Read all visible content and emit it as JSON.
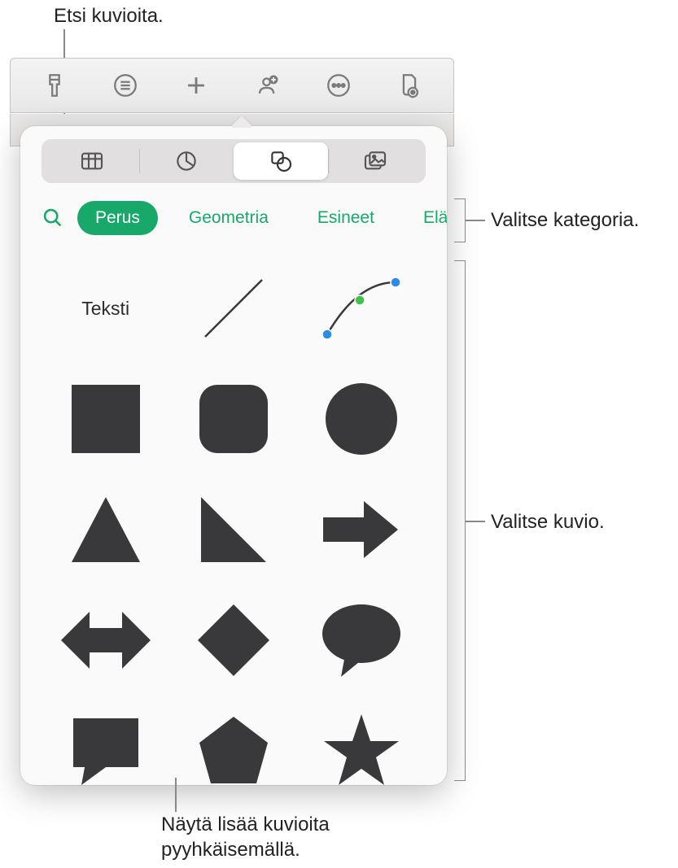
{
  "callouts": {
    "search": "Etsi kuvioita.",
    "category": "Valitse kategoria.",
    "shape": "Valitse kuvio.",
    "more": "Näytä lisää kuvioita pyyhkäisemällä."
  },
  "segmented": {
    "items": [
      "table",
      "chart",
      "shape",
      "media"
    ],
    "active_index": 2
  },
  "categories": {
    "items": [
      "Perus",
      "Geometria",
      "Esineet",
      "Eläin"
    ],
    "active_index": 0
  },
  "shapes": {
    "text_label": "Teksti"
  },
  "colors": {
    "accent": "#17a86a",
    "shape_fill": "#39393b",
    "icon_gray": "#7a7a7a"
  }
}
